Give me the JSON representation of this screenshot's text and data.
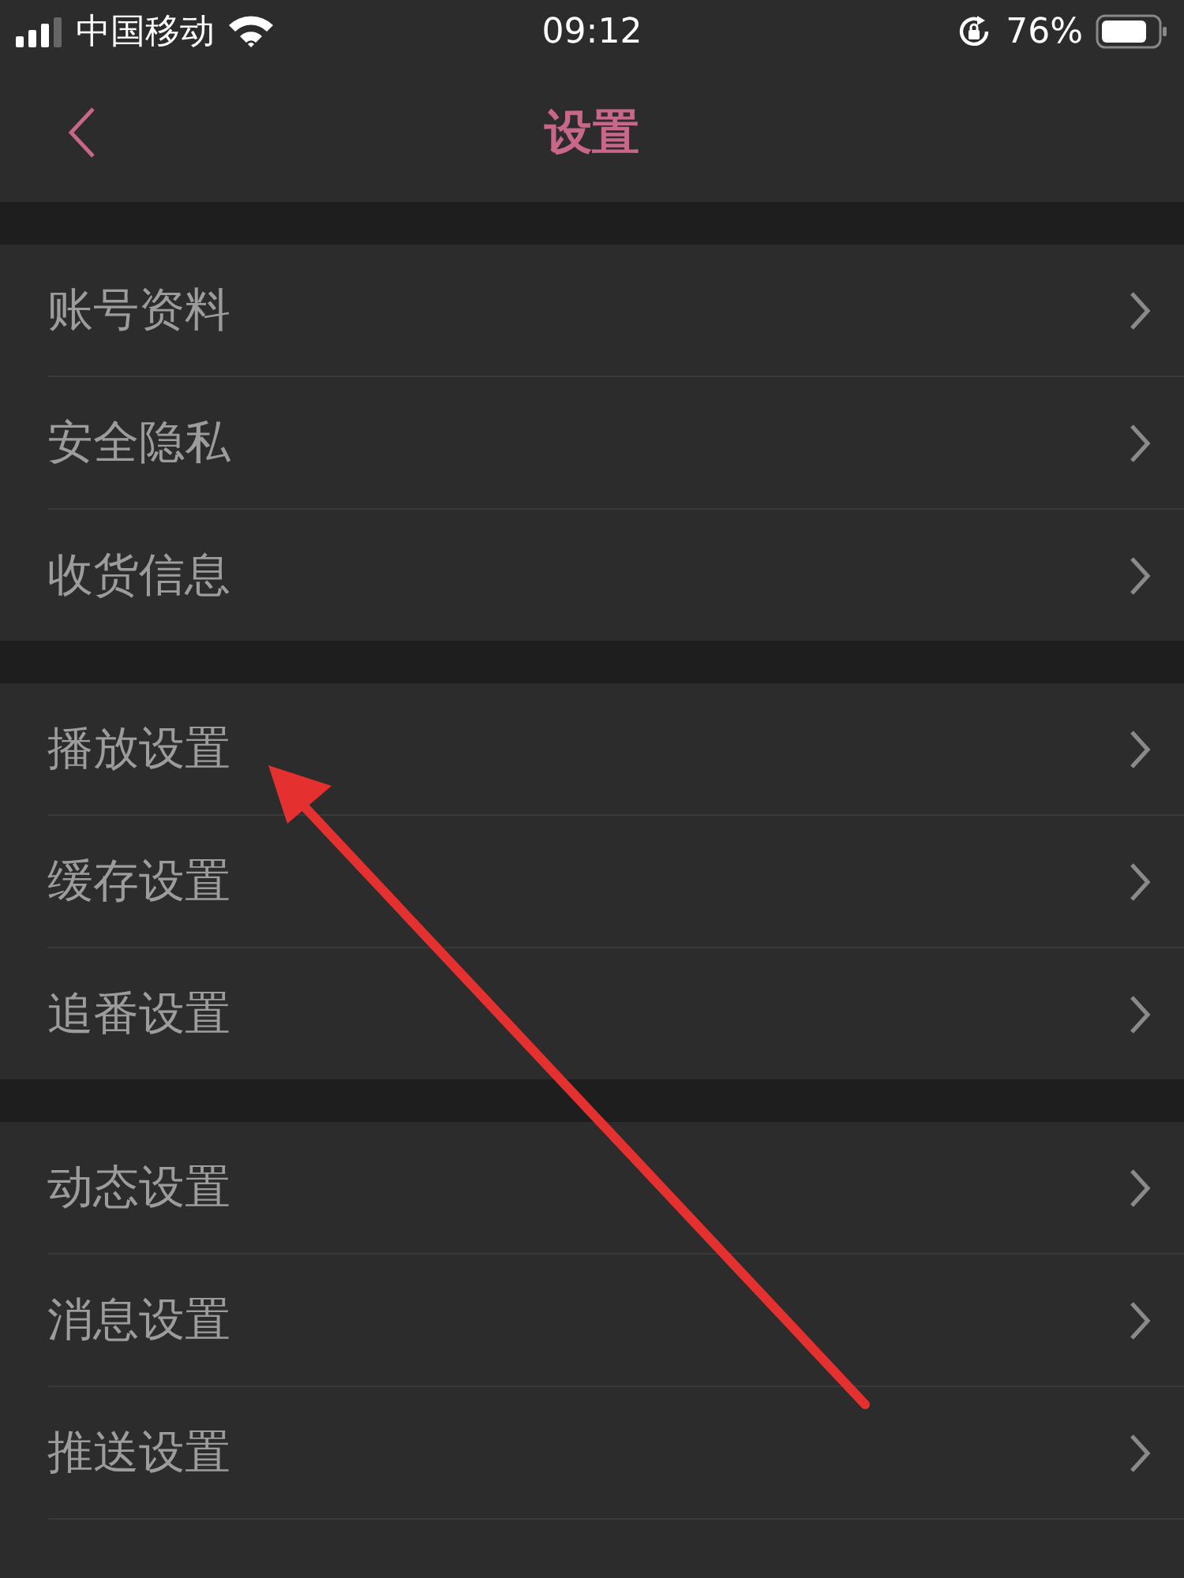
{
  "status_bar": {
    "carrier": "中国移动",
    "time": "09:12",
    "battery": "76%"
  },
  "nav_bar": {
    "title": "设置"
  },
  "groups": [
    {
      "items": [
        {
          "label": "账号资料"
        },
        {
          "label": "安全隐私"
        },
        {
          "label": "收货信息"
        }
      ]
    },
    {
      "items": [
        {
          "label": "播放设置"
        },
        {
          "label": "缓存设置"
        },
        {
          "label": "追番设置"
        }
      ]
    },
    {
      "items": [
        {
          "label": "动态设置"
        },
        {
          "label": "消息设置"
        },
        {
          "label": "推送设置"
        },
        {
          "kind": "cut"
        }
      ]
    }
  ]
}
